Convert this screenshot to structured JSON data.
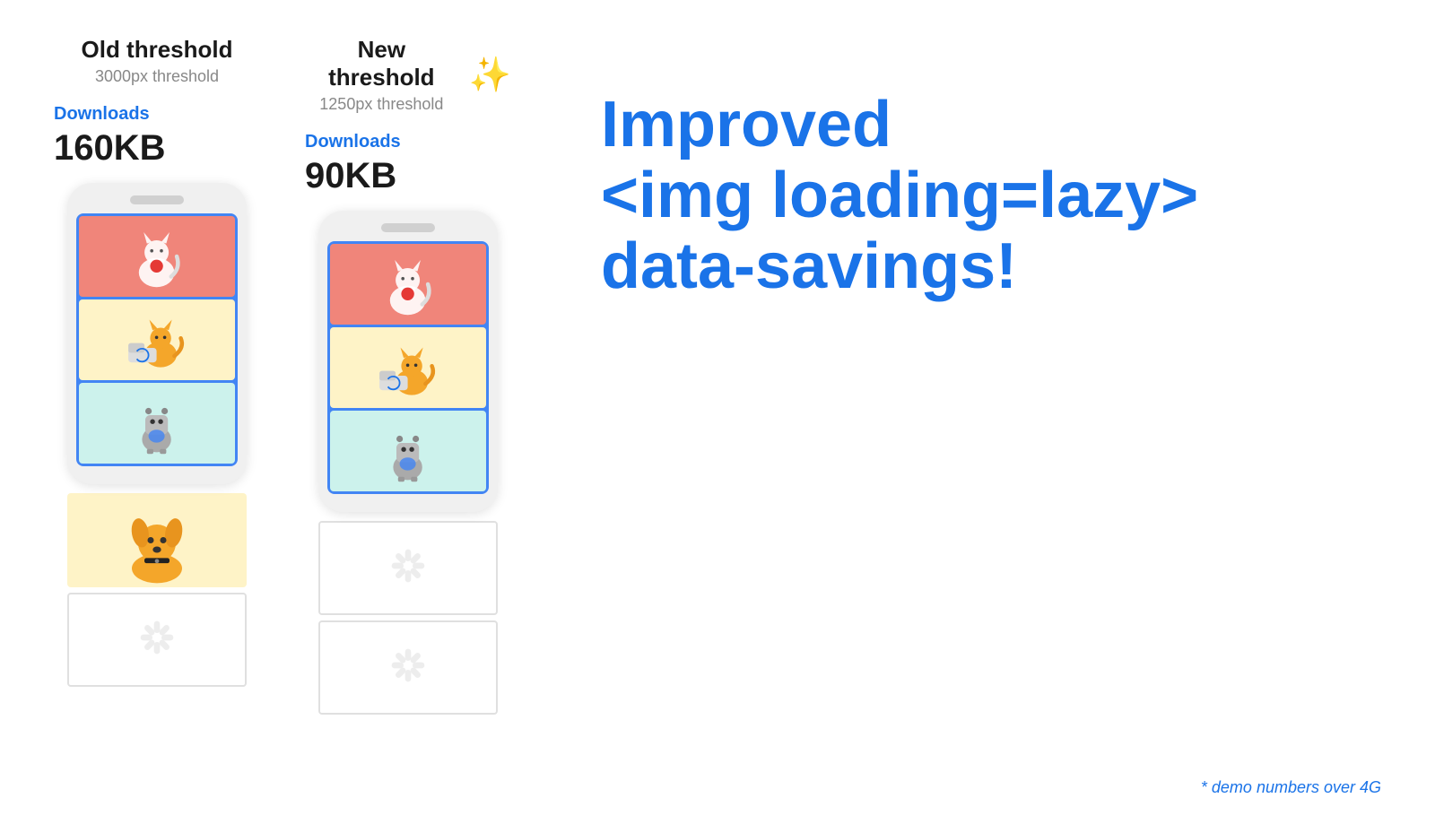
{
  "old_threshold": {
    "title": "Old threshold",
    "subtitle": "3000px threshold",
    "downloads_label": "Downloads",
    "downloads_size": "160KB"
  },
  "new_threshold": {
    "title": "New threshold",
    "subtitle": "1250px threshold",
    "downloads_label": "Downloads",
    "downloads_size": "90KB",
    "sparkle": "✨"
  },
  "improved_text": {
    "line1": "Improved",
    "line2": "<img loading=lazy>",
    "line3": "data-savings!"
  },
  "demo_note": "* demo numbers over 4G"
}
